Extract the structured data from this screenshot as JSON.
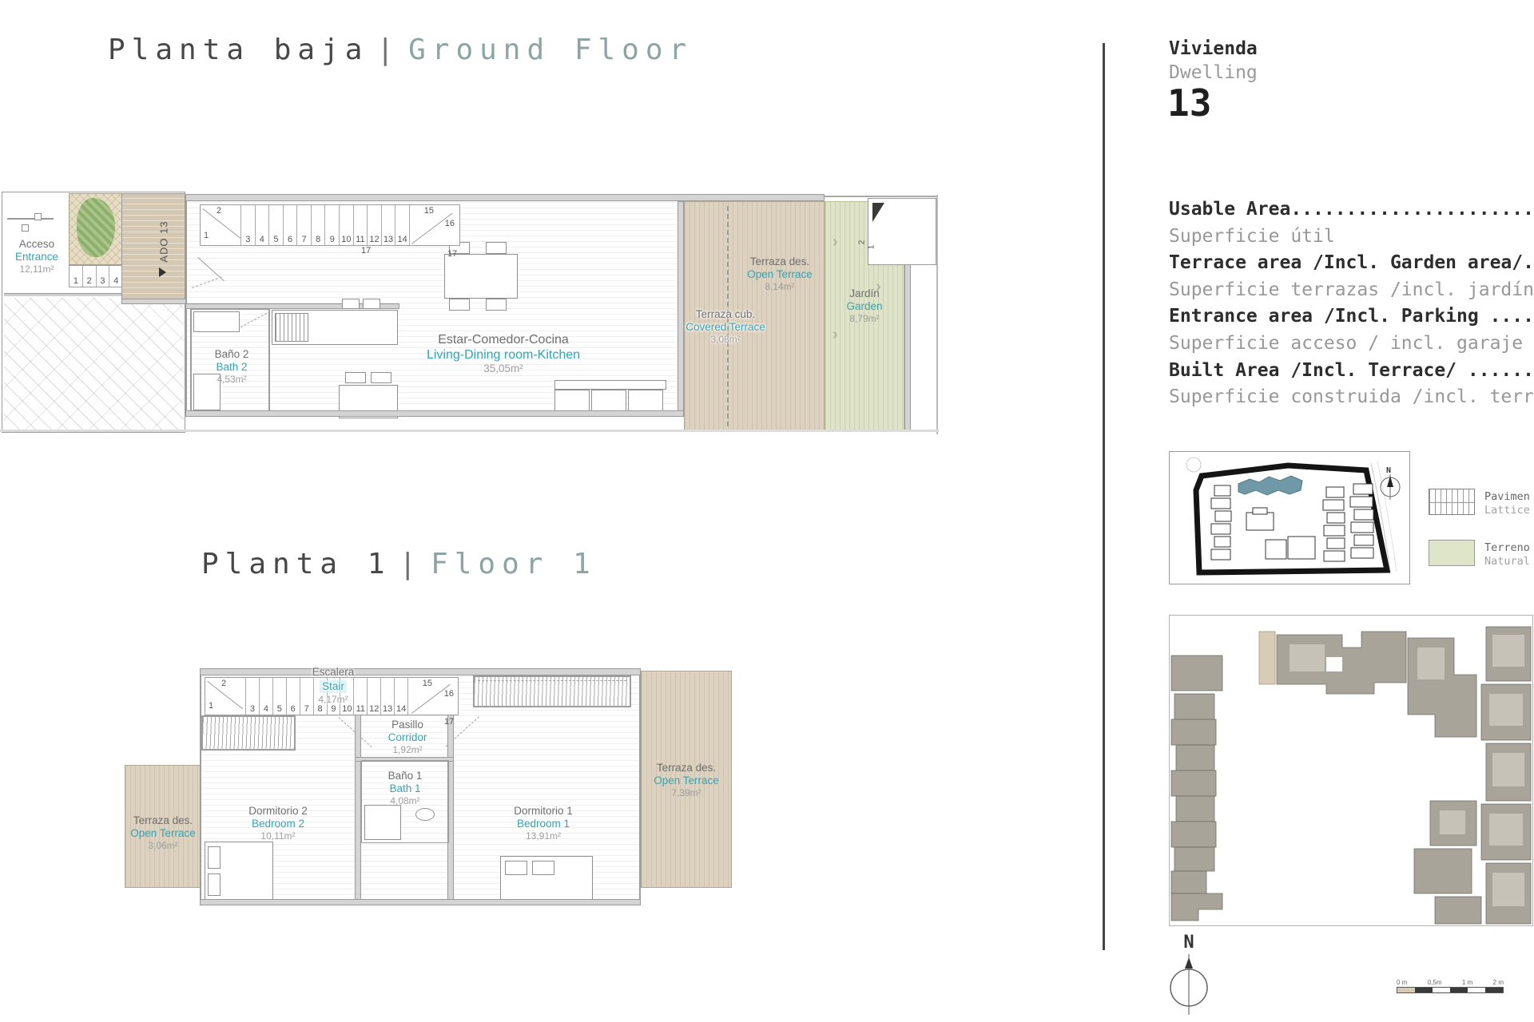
{
  "titles": {
    "ground": {
      "es": "Planta baja",
      "sep": "|",
      "en": "Ground Floor"
    },
    "first": {
      "es": "Planta 1",
      "sep": "|",
      "en": "Floor 1"
    }
  },
  "dwelling": {
    "es": "Vivienda",
    "en": "Dwelling",
    "number": "13"
  },
  "specs": [
    {
      "bold": "Usable Area..............................",
      "light": "Superficie útil"
    },
    {
      "bold": "Terrace area /Incl. Garden area/.........",
      "light": "Superficie terrazas /incl. jardín/"
    },
    {
      "bold": "Entrance area /Incl. Parking ............",
      "light": "Superficie acceso / incl. garaje"
    },
    {
      "bold": "Built Area /Incl. Terrace/ ..............",
      "light": "Superficie construida /incl. terraza/"
    }
  ],
  "gf": {
    "acceso": {
      "es": "Acceso",
      "en": "Entrance",
      "area": "12,11m²"
    },
    "ado": "ADO 13",
    "bath2": {
      "es": "Baño 2",
      "en": "Bath 2",
      "area": "4,53m²"
    },
    "living": {
      "es": "Estar-Comedor-Cocina",
      "en": "Living-Dining room-Kitchen",
      "area": "35,05m²"
    },
    "open_terrace": {
      "es": "Terraza des.",
      "en": "Open Terrace",
      "area": "8,14m²"
    },
    "covered_terrace": {
      "es": "Terraza cub.",
      "en": "Covered Terrace",
      "area": "3,08m²"
    },
    "garden": {
      "es": "Jardín",
      "en": "Garden",
      "area": "8,79m²"
    },
    "entry_steps": [
      "1",
      "2",
      "3",
      "4"
    ],
    "stair_row": [
      "3",
      "4",
      "5",
      "6",
      "7",
      "8",
      "9",
      "10",
      "11",
      "12",
      "13",
      "14"
    ],
    "marks": {
      "s1": "1",
      "s2": "2",
      "s15": "15",
      "s16": "16",
      "s17": "17"
    },
    "garden_steps": [
      "2",
      "1"
    ]
  },
  "f1": {
    "stair": {
      "es": "Escalera",
      "en": "Stair",
      "area": "4,17m²"
    },
    "corridor": {
      "es": "Pasillo",
      "en": "Corridor",
      "area": "1,92m²"
    },
    "bath1": {
      "es": "Baño 1",
      "en": "Bath 1",
      "area": "4,08m²"
    },
    "bedroom2": {
      "es": "Dormitorio 2",
      "en": "Bedroom 2",
      "area": "10,11m²"
    },
    "bedroom1": {
      "es": "Dormitorio 1",
      "en": "Bedroom 1",
      "area": "13,91m²"
    },
    "terrace_left": {
      "es": "Terraza des.",
      "en": "Open Terrace",
      "area": "3,06m²"
    },
    "terrace_right": {
      "es": "Terraza des.",
      "en": "Open Terrace",
      "area": "7,39m²"
    },
    "stair_row": [
      "3",
      "4",
      "5",
      "6",
      "7",
      "8",
      "9",
      "10",
      "11",
      "12",
      "13",
      "14"
    ],
    "marks": {
      "s1": "1",
      "s2": "2",
      "s15": "15",
      "s16": "16",
      "s17": "17"
    }
  },
  "legend": [
    {
      "line1": "Pavimen",
      "line2": "Lattice"
    },
    {
      "line1": "Terreno",
      "line2": "Natural"
    }
  ],
  "compass": {
    "label": "N"
  },
  "scalebar": [
    "0 m",
    "0,5m",
    "1 m",
    "2 m"
  ],
  "colors": {
    "teal_label": "#2fa6b8",
    "title_teal": "#8ca4a4",
    "terrace_beige": "#ddd1bf",
    "garden_green": "#dfe4c9",
    "highlight_building": "#6f99a6"
  }
}
